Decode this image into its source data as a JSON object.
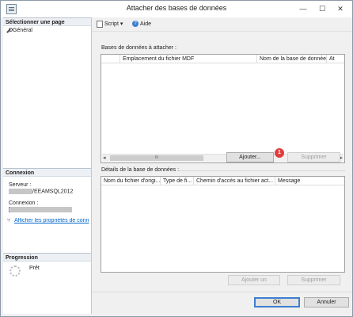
{
  "window": {
    "title": "Attacher des bases de données",
    "min_glyph": "—",
    "max_glyph": "☐",
    "close_glyph": "✕"
  },
  "left_panel": {
    "select_page_header": "Sélectionner une page",
    "pages": [
      {
        "label": "Général"
      }
    ],
    "connection_header": "Connexion",
    "server_label": "Serveur :",
    "server_value": "/EEAMSQL2012",
    "connection_label": "Connexion :",
    "connection_value": "[",
    "connection_props_link": "Afficher les propriétés de conn",
    "progress_header": "Progression",
    "progress_status": "Prêt"
  },
  "toolbar": {
    "script_label": "Script",
    "script_dropdown": "▾",
    "help_label": "Aide"
  },
  "attach_section": {
    "label": "Bases de données à attacher :",
    "columns": [
      "Emplacement du fichier MDF",
      "Nom de la base de données",
      "At"
    ],
    "scroll_thumb": "III",
    "add_button": "Ajouter...",
    "remove_button": "Supprimer",
    "badge": "1"
  },
  "details_section": {
    "label": "Détails de la base de données :",
    "columns": [
      "Nom du fichier d'origi...",
      "Type de fi...",
      "Chemin d'accès au fichier act...",
      "Message"
    ],
    "add_catalog_button": "Ajouter un",
    "remove_button": "Supprimer"
  },
  "footer": {
    "ok_button": "OK",
    "cancel_button": "Annuler"
  },
  "colors": {
    "accent": "#3c7fd1",
    "badge": "#e23c3c",
    "link": "#0066cc"
  }
}
